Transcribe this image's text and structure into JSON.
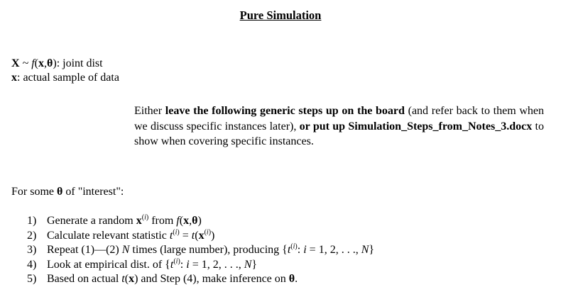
{
  "title": "Pure Simulation",
  "definitions": [
    {
      "symbol": "X ~ f(x,θ)",
      "text": ": joint dist"
    },
    {
      "symbol": "x",
      "text": ": actual sample of data"
    }
  ],
  "note": {
    "p1": "Either ",
    "b1": "leave the following generic steps up on the board",
    "p2": " (and refer back to them when we discuss specific instances later), ",
    "b2": "or put up Simulation_Steps_from_Notes_3.docx",
    "p3": " to show when covering specific instances."
  },
  "interest_line": "For some θ of \"interest\":",
  "steps": [
    "1) Generate a random x(i) from f(x,θ)",
    "2) Calculate relevant statistic t(i) = t(x(i))",
    "3) Repeat (1)—(2) N times (large number), producing {t(i): i = 1, 2, . . ., N}",
    "4) Look at empirical dist. of {t(i): i = 1, 2, . . ., N}",
    "5) Based on actual t(x) and Step (4), make inference on θ."
  ]
}
